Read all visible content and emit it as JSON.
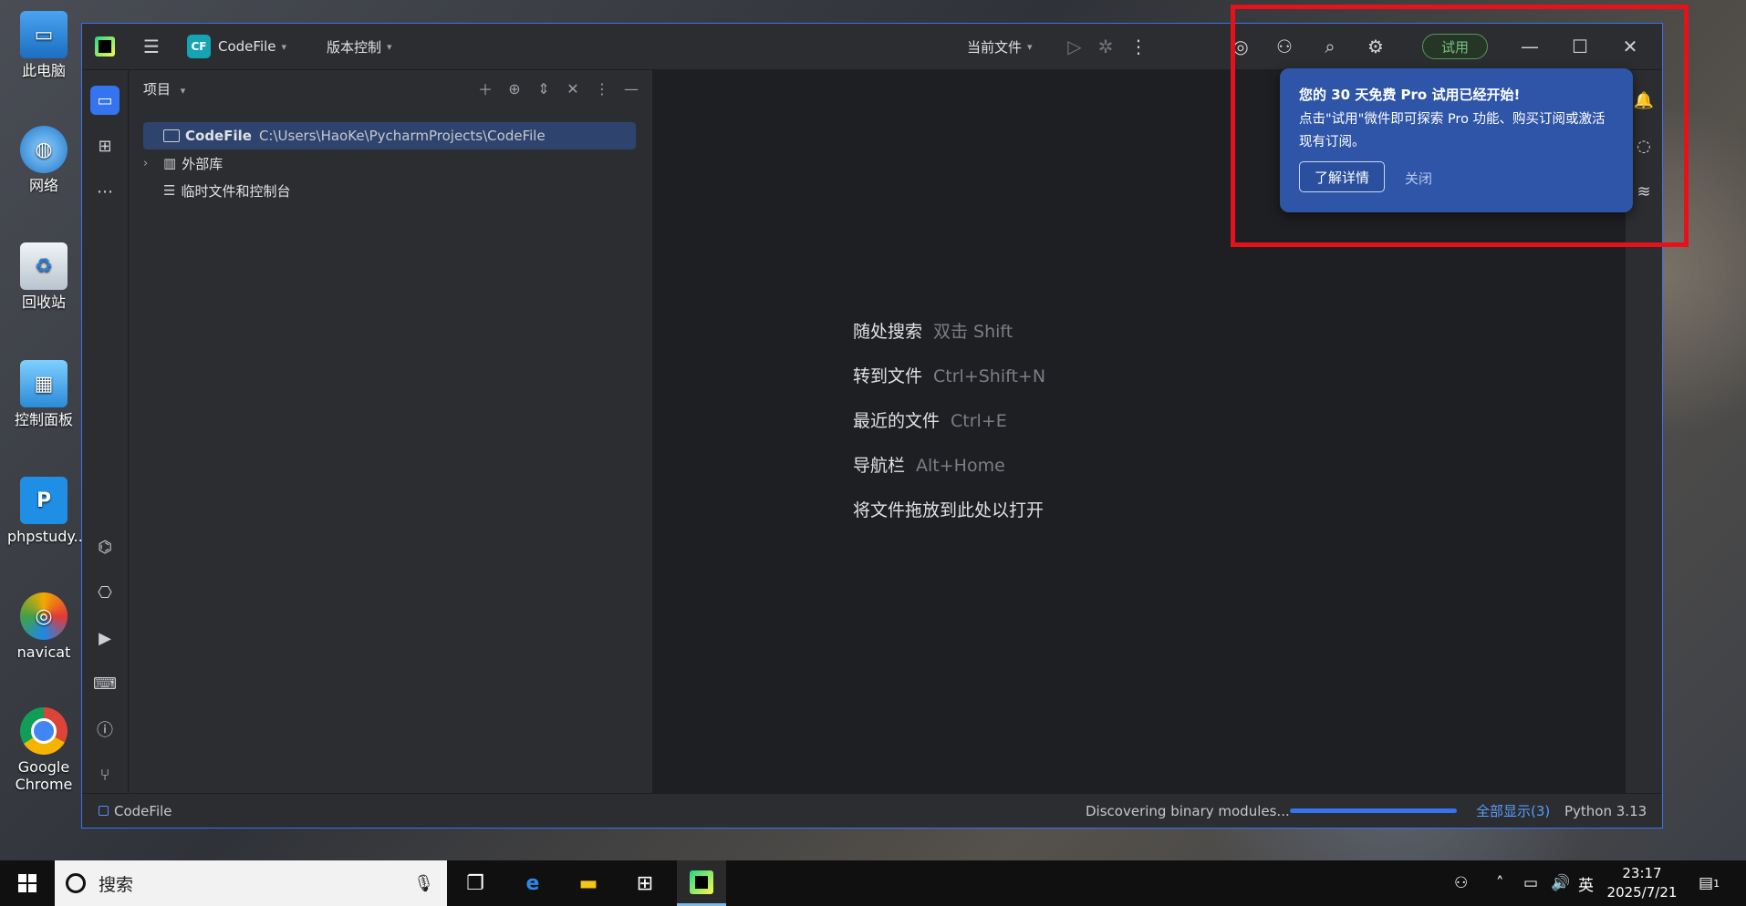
{
  "desktop": {
    "icons": [
      {
        "label": "此电脑",
        "icon": "computer-icon"
      },
      {
        "label": "网络",
        "icon": "network-globe-icon"
      },
      {
        "label": "回收站",
        "icon": "recycle-bin-icon"
      },
      {
        "label": "控制面板",
        "icon": "control-panel-icon"
      },
      {
        "label": "phpstudy...",
        "icon": "phpstudy-icon"
      },
      {
        "label": "navicat",
        "icon": "navicat-icon"
      },
      {
        "label": "Google Chrome",
        "icon": "chrome-icon"
      }
    ]
  },
  "ide": {
    "project_name": "CodeFile",
    "project_badge": "CF",
    "vcs_label": "版本控制",
    "run_config": "当前文件",
    "trial_label": "试用",
    "project_panel": {
      "title": "项目",
      "tree": [
        {
          "name": "CodeFile",
          "path": "C:\\Users\\HaoKe\\PycharmProjects\\CodeFile"
        },
        {
          "name": "外部库"
        },
        {
          "name": "临时文件和控制台"
        }
      ]
    },
    "editor_hints": [
      {
        "label": "随处搜索",
        "key": "双击 Shift"
      },
      {
        "label": "转到文件",
        "key": "Ctrl+Shift+N"
      },
      {
        "label": "最近的文件",
        "key": "Ctrl+E"
      },
      {
        "label": "导航栏",
        "key": "Alt+Home"
      },
      {
        "label": "将文件拖放到此处以打开",
        "key": ""
      }
    ],
    "status": {
      "breadcrumb": "CodeFile",
      "task": "Discovering binary modules...",
      "progress": 1.0,
      "show_all": "全部显示(3)",
      "interpreter": "Python 3.13"
    },
    "notification": {
      "title": "您的 30 天免费 Pro 试用已经开始!",
      "message": "点击\"试用\"微件即可探索 Pro 功能、购买订阅或激活现有订阅。",
      "learn_more": "了解详情",
      "close": "关闭"
    }
  },
  "taskbar": {
    "search_placeholder": "搜索",
    "ime": "英",
    "time": "23:17",
    "date": "2025/7/21",
    "notification_count": "1"
  },
  "colors": {
    "accent": "#3574f0",
    "popup_bg": "#2f55a8",
    "annotation_red": "#e8101a",
    "trial_green": "#73c27a"
  }
}
